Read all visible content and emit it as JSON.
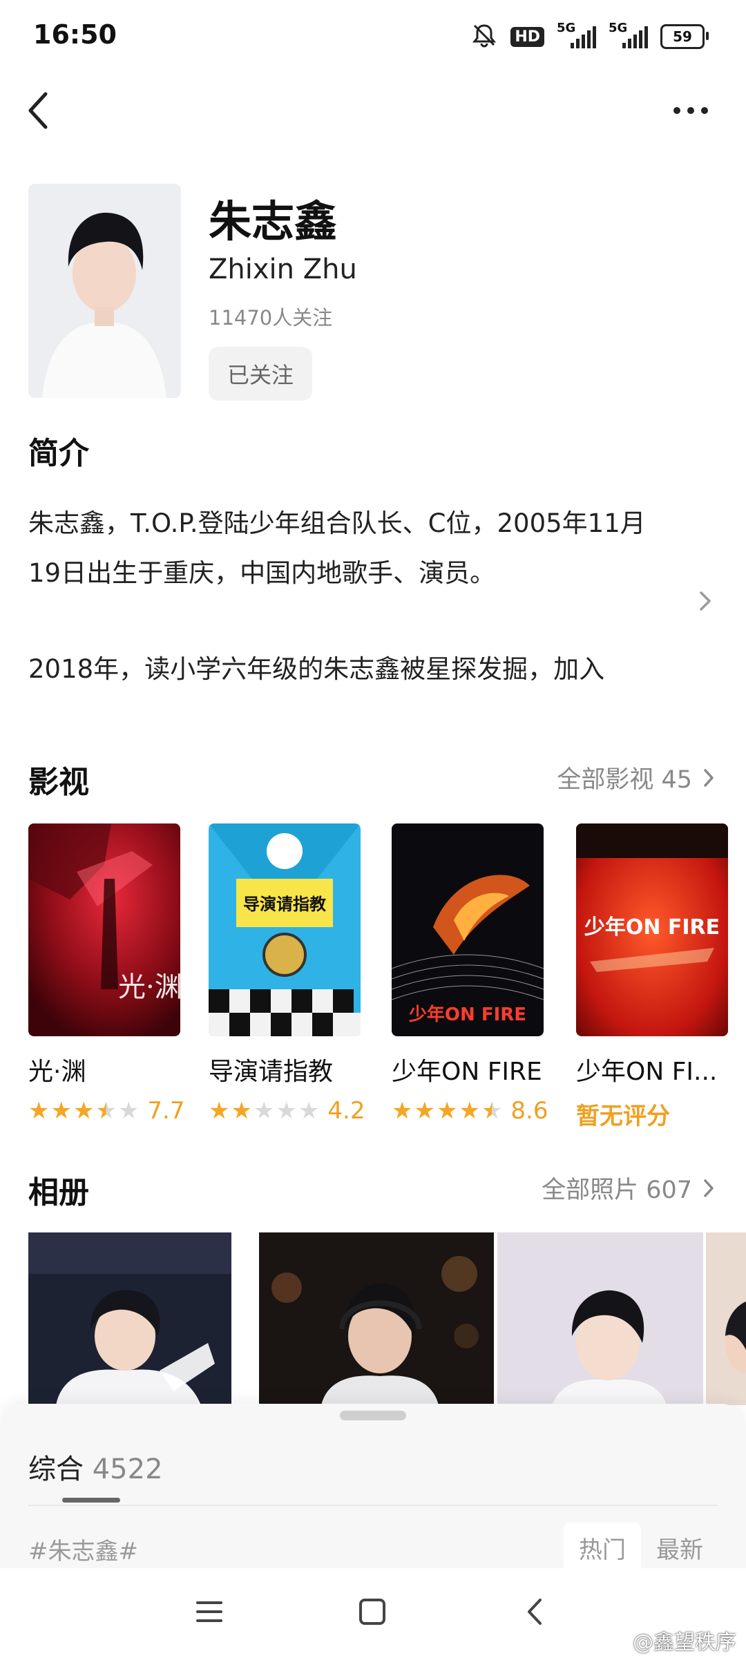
{
  "status_bar": {
    "time": "16:50",
    "hd": "HD",
    "signal1": "5G",
    "signal2": "5G",
    "battery": "59"
  },
  "profile": {
    "name_cn": "朱志鑫",
    "name_en": "Zhixin Zhu",
    "followers": "11470人关注",
    "follow_state": "已关注"
  },
  "intro": {
    "title": "简介",
    "text": "朱志鑫，T.O.P.登陆少年组合队长、C位，2005年11月19日出生于重庆，中国内地歌手、演员。",
    "text2": "2018年，读小学六年级的朱志鑫被星探发掘，加入"
  },
  "films": {
    "title": "影视",
    "more": "全部影视 45",
    "items": [
      {
        "title": "光·渊",
        "stars": 3.5,
        "score": "7.7",
        "poster_text": "光·渊"
      },
      {
        "title": "导演请指教",
        "stars": 2,
        "score": "4.2",
        "poster_text": "导演请指教"
      },
      {
        "title": "少年ON FIRE",
        "stars": 4.5,
        "score": "8.6",
        "poster_text": "少年ON FIRE"
      },
      {
        "title": "少年ON FI...",
        "stars": 0,
        "score": "暂无评分",
        "poster_text": "少年ON FIRE"
      }
    ]
  },
  "album": {
    "title": "相册",
    "more": "全部照片 607"
  },
  "sheet": {
    "tab": "综合",
    "tab_count": "4522",
    "hashtag": "#朱志鑫#",
    "sort_hot": "热门",
    "sort_new": "最新"
  },
  "watermark": "@鑫望秩序",
  "colors": {
    "star_on": "#f5a623",
    "star_off": "#d9d9d9",
    "score": "#f0a020"
  }
}
